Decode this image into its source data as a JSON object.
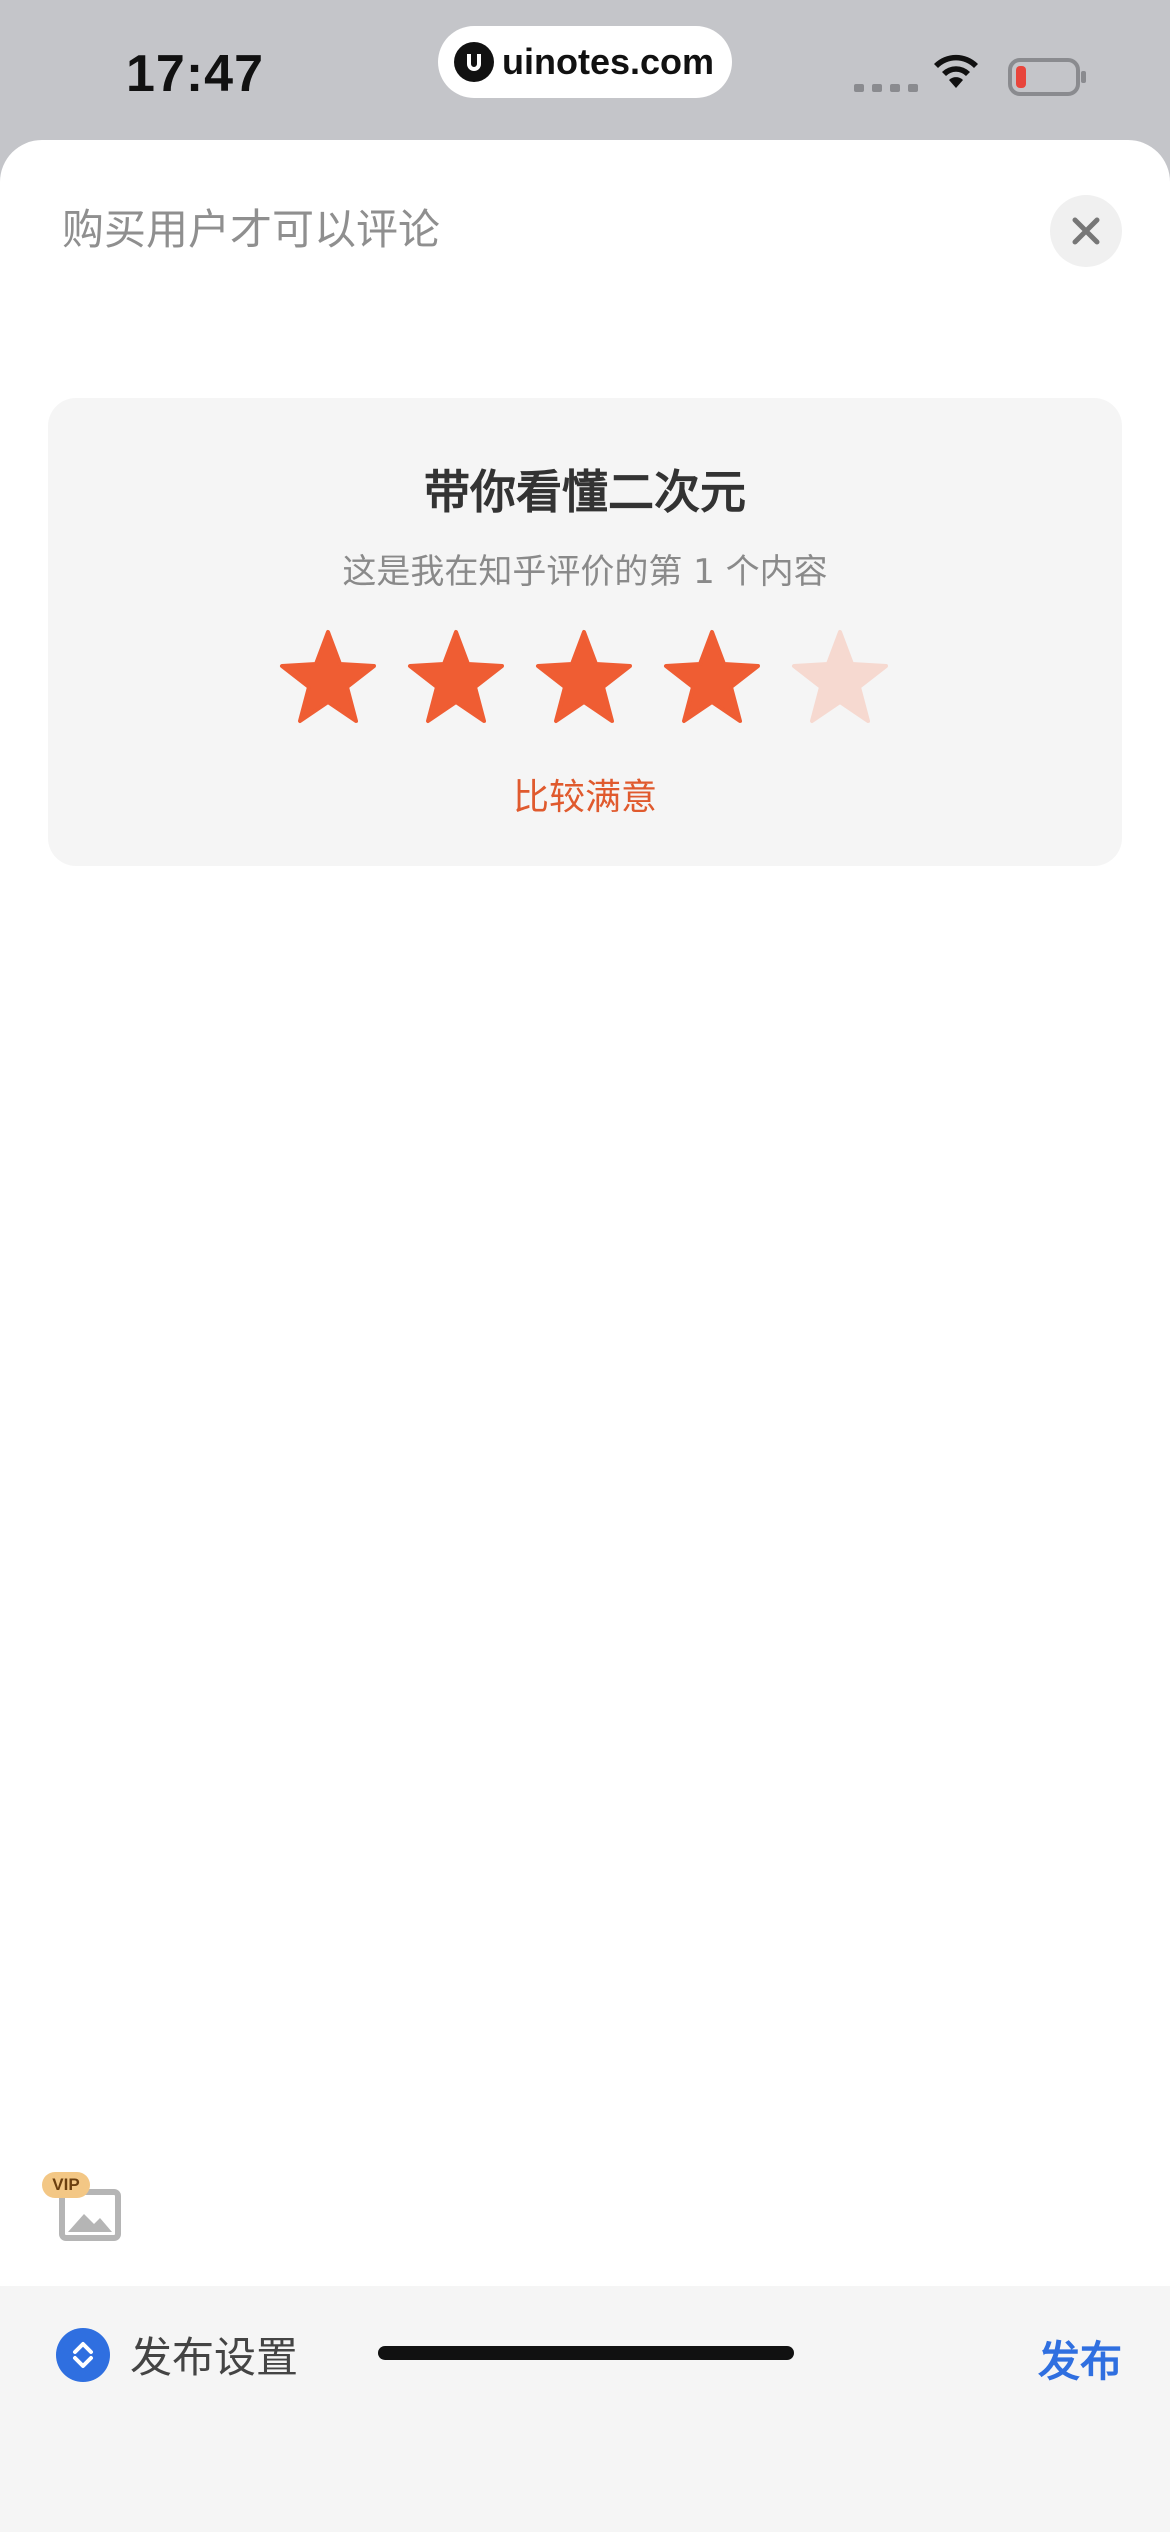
{
  "status_bar": {
    "time": "17:47",
    "url": "uinotes.com",
    "wifi_icon": "wifi-icon",
    "battery_icon": "battery-low-icon",
    "battery_color": "#e8453c"
  },
  "sheet": {
    "hint": "购买用户才可以评论",
    "close_icon": "close-icon"
  },
  "rating_card": {
    "title": "带你看懂二次元",
    "subtitle": "这是我在知乎评价的第 1 个内容",
    "rating": 4,
    "max_rating": 5,
    "rating_label": "比较满意",
    "star_active_color": "#ef5d33",
    "star_inactive_color": "#f6d9d0"
  },
  "image_button": {
    "badge": "VIP",
    "icon": "image-icon"
  },
  "bottom_bar": {
    "settings_label": "发布设置",
    "publish_label": "发布",
    "accent_color": "#2f6fe0"
  }
}
